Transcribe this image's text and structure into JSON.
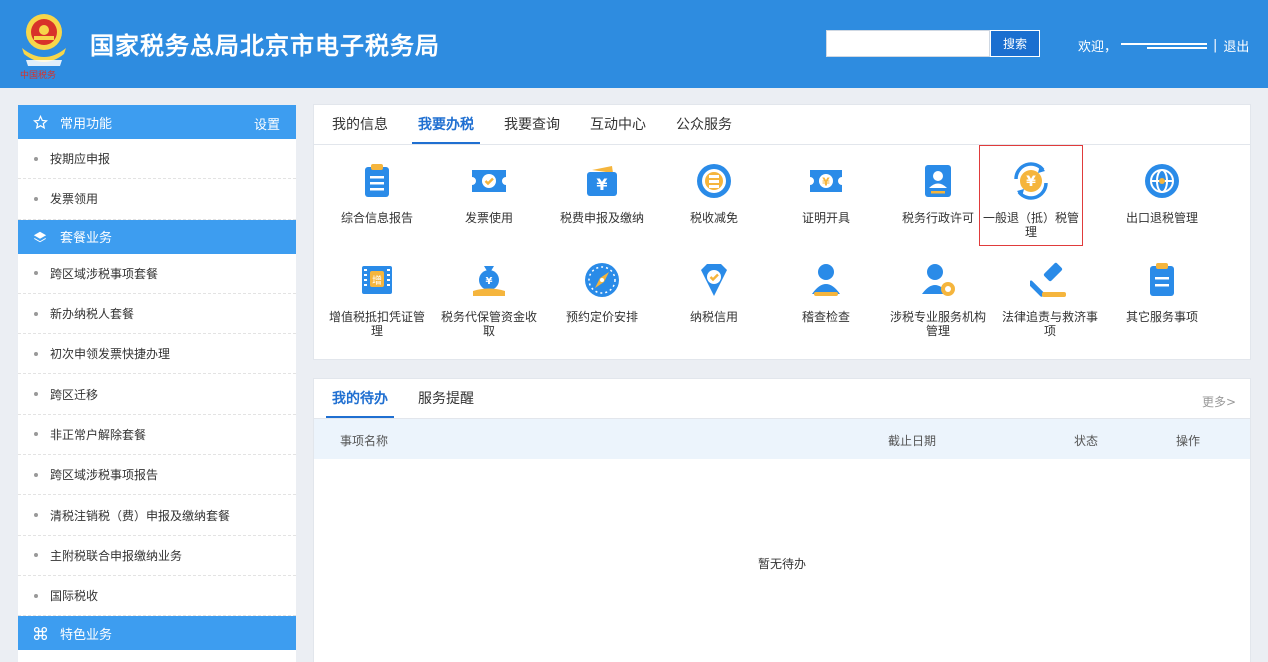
{
  "header": {
    "title": "国家税务总局北京市电子税务局",
    "search_button": "搜索",
    "welcome": "欢迎，",
    "separator": "|",
    "logout": "退出"
  },
  "sidebar": {
    "common": {
      "title": "常用功能",
      "setting": "设置",
      "items": [
        "按期应申报",
        "发票领用"
      ]
    },
    "package": {
      "title": "套餐业务",
      "items": [
        "跨区域涉税事项套餐",
        "新办纳税人套餐",
        "初次申领发票快捷办理",
        "跨区迁移",
        "非正常户解除套餐",
        "跨区域涉税事项报告",
        "清税注销税（费）申报及缴纳套餐",
        "主附税联合申报缴纳业务",
        "国际税收"
      ]
    },
    "special": {
      "title": "特色业务"
    }
  },
  "main_tabs": [
    "我的信息",
    "我要办税",
    "我要查询",
    "互动中心",
    "公众服务"
  ],
  "active_main_tab": 1,
  "services": [
    {
      "label": "综合信息报告",
      "icon": "clipboard-list-icon"
    },
    {
      "label": "发票使用",
      "icon": "invoice-ticket-icon"
    },
    {
      "label": "税费申报及缴纳",
      "icon": "yuan-wallet-icon"
    },
    {
      "label": "税收减免",
      "icon": "coin-stack-icon"
    },
    {
      "label": "证明开具",
      "icon": "certificate-ticket-icon"
    },
    {
      "label": "税务行政许可",
      "icon": "id-card-icon"
    },
    {
      "label": "一般退（抵）税管理",
      "icon": "yuan-refresh-icon"
    },
    {
      "label": "出口退税管理",
      "icon": "globe-icon"
    },
    {
      "label": "增值税抵扣凭证管理",
      "icon": "vat-voucher-icon"
    },
    {
      "label": "税务代保管资金收取",
      "icon": "money-bag-hand-icon"
    },
    {
      "label": "预约定价安排",
      "icon": "compass-icon"
    },
    {
      "label": "纳税信用",
      "icon": "diamond-check-icon"
    },
    {
      "label": "稽查检查",
      "icon": "inspector-person-icon"
    },
    {
      "label": "涉税专业服务机构管理",
      "icon": "person-gear-icon"
    },
    {
      "label": "法律追责与救济事项",
      "icon": "gavel-icon"
    },
    {
      "label": "其它服务事项",
      "icon": "clipboard-icon"
    }
  ],
  "todo": {
    "tabs": [
      "我的待办",
      "服务提醒"
    ],
    "more": "更多>",
    "columns": [
      "事项名称",
      "截止日期",
      "状态",
      "操作"
    ],
    "empty": "暂无待办"
  },
  "colors": {
    "header": "#2e8ce0",
    "accent": "#1f6fd1",
    "sidebar_head": "#3d9df0",
    "highlight": "#e03b3b"
  }
}
